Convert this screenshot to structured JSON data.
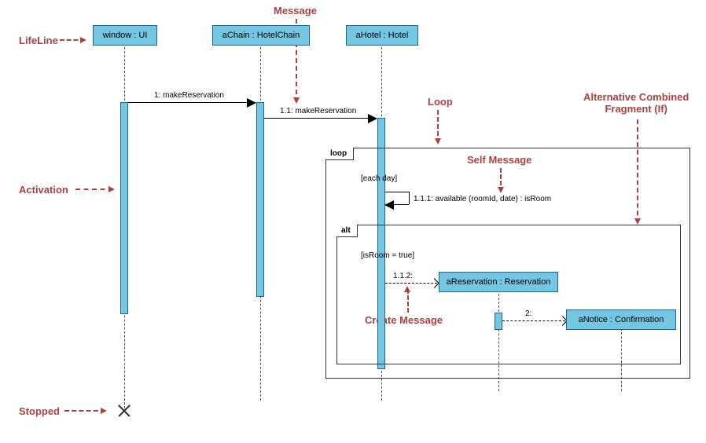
{
  "annotations": {
    "message": "Message",
    "lifeline": "LifeLine",
    "loop": "Loop",
    "altFragment": "Alternative Combined\nFragment (If)",
    "selfMessage": "Self Message",
    "activation": "Activation",
    "createMessage": "Create Message",
    "stopped": "Stopped"
  },
  "lifelines": {
    "window": "window : UI",
    "chain": "aChain : HotelChain",
    "hotel": "aHotel : Hotel",
    "reservation": "aReservation : Reservation",
    "notice": "aNotice : Confirmation"
  },
  "messages": {
    "m1": "1: makeReservation",
    "m11": "1.1: makeReservation",
    "m111": "1.1.1: available (roomId, date) : isRoom",
    "m112": "1.1.2:",
    "m2": "2:"
  },
  "fragments": {
    "loopLabel": "loop",
    "loopGuard": "[each day]",
    "altLabel": "alt",
    "altGuard": "[isRoom = true]"
  }
}
